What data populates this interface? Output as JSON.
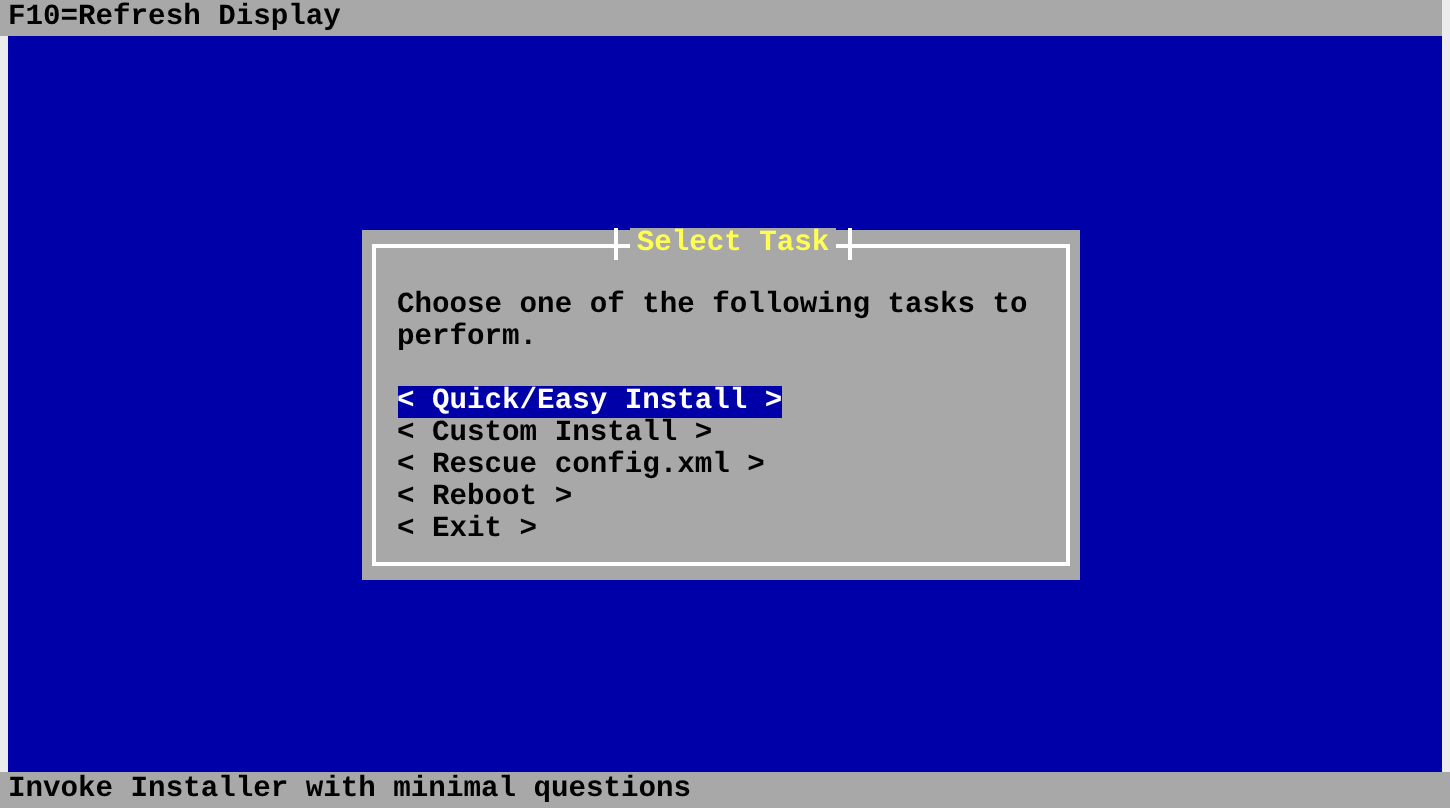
{
  "top_bar": {
    "text": "F10=Refresh Display"
  },
  "dialog": {
    "title": "Select Task",
    "message": "Choose one of the following tasks to perform.",
    "options": [
      {
        "label": "< Quick/Easy Install >",
        "selected": true
      },
      {
        "label": "< Custom Install >",
        "selected": false
      },
      {
        "label": "< Rescue config.xml >",
        "selected": false
      },
      {
        "label": "< Reboot >",
        "selected": false
      },
      {
        "label": "< Exit >",
        "selected": false
      }
    ]
  },
  "status_bar": {
    "text": "Invoke Installer with minimal questions"
  }
}
